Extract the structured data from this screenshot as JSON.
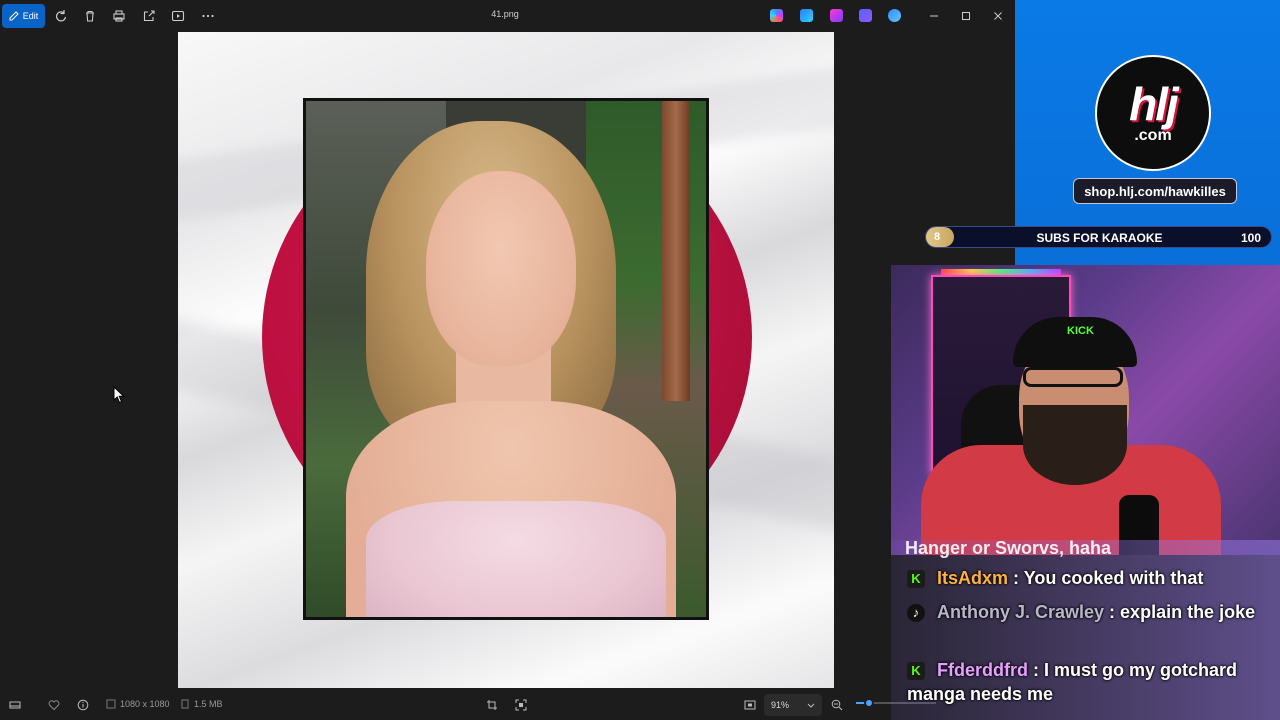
{
  "toolbar": {
    "edit_label": "Edit",
    "file_title": "41.png",
    "icons": [
      "rotate-icon",
      "delete-icon",
      "print-icon",
      "share-icon",
      "slideshow-icon",
      "more-icon"
    ],
    "app_icons": [
      "copilot-icon",
      "designer-icon",
      "clipchamp-icon",
      "teams-icon",
      "onedrive-icon"
    ]
  },
  "statusbar": {
    "dimensions": "1080 x 1080",
    "file_size": "1.5 MB",
    "zoom": "91%",
    "zoom_level_fraction": 0.15
  },
  "overlay": {
    "logo_text": "hlj",
    "logo_sub": ".com",
    "shop_url": "shop.hlj.com/hawkilles",
    "goal": {
      "current": "8",
      "title": "SUBS FOR KARAOKE",
      "target": "100",
      "progress_fraction": 0.08
    },
    "webcam_cap_text": "KICK"
  },
  "chat": {
    "cut_line": "Hanger or Sworvs, haha",
    "messages": [
      {
        "platform": "K",
        "platform_name": "kick",
        "user": "ItsAdxm",
        "sep": " : ",
        "text": "You cooked with that"
      },
      {
        "platform": "♪",
        "platform_name": "tiktok",
        "user": "Anthony J. Crawley",
        "sep": " : ",
        "text": "explain the joke"
      },
      {
        "platform": "K",
        "platform_name": "kick",
        "user": "Ffderddfrd",
        "sep": " : ",
        "text": "I must go my gotchard manga needs me"
      }
    ]
  },
  "colors": {
    "accent": "#0a64c8",
    "overlay_blue": "#0a7ae6",
    "flag_red": "#c0103f",
    "kick_green": "#53fc18"
  }
}
